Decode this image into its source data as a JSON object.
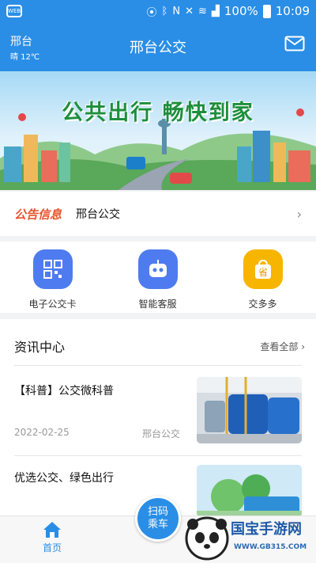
{
  "statusbar": {
    "battery": "100%",
    "time": "10:09",
    "app_badge": "WEB"
  },
  "header": {
    "city": "邢台",
    "weather": "晴 12℃",
    "title": "邢台公交"
  },
  "banner": {
    "slogan": "公共出行   畅快到家"
  },
  "notice": {
    "tag": "公告信息",
    "text": "邢台公交"
  },
  "quick_actions": [
    {
      "label": "电子公交卡",
      "icon": "qr-code-icon",
      "color": "#4e7cf0"
    },
    {
      "label": "智能客服",
      "icon": "robot-icon",
      "color": "#4e7cf0"
    },
    {
      "label": "交多多",
      "icon": "shopping-bag-icon",
      "color": "#f7b500"
    }
  ],
  "news": {
    "title": "资讯中心",
    "more": "查看全部",
    "items": [
      {
        "title": "【科普】公交微科普",
        "date": "2022-02-25",
        "source": "邢台公交"
      },
      {
        "title": "优选公交、绿色出行"
      }
    ]
  },
  "tabbar": {
    "home": "首页",
    "scan_line1": "扫码",
    "scan_line2": "乘车"
  },
  "watermark": {
    "text": "国宝手游网",
    "url": "WWW.GB315.COM"
  },
  "colors": {
    "primary": "#2a8ee6",
    "notice_tag": "#e8542c"
  }
}
